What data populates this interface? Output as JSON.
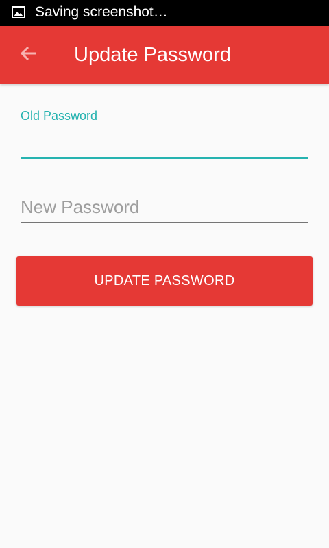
{
  "status_bar": {
    "notification_icon": "image-icon",
    "text": "Saving screenshot…"
  },
  "toolbar": {
    "back_icon": "arrow-left-icon",
    "title": "Update Password",
    "color": "#e53935"
  },
  "form": {
    "old_password": {
      "label": "Old Password",
      "value": "",
      "accent_color": "#26b3b0"
    },
    "new_password": {
      "placeholder": "New Password",
      "value": ""
    },
    "submit_label": "UPDATE PASSWORD"
  }
}
